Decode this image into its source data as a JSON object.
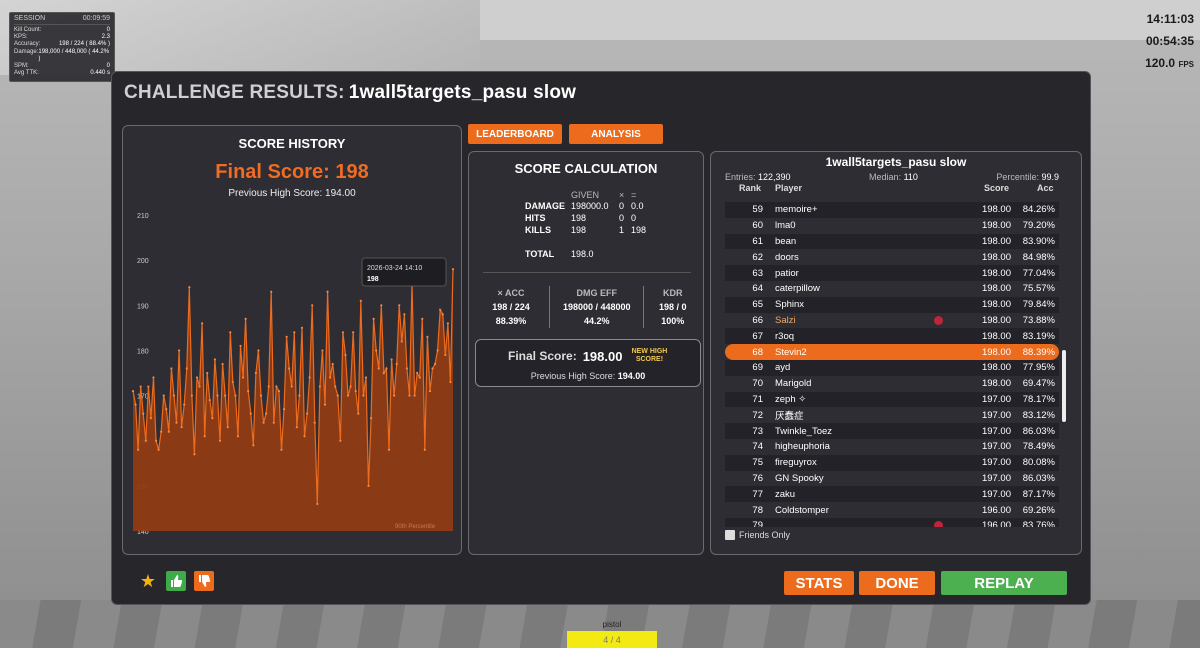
{
  "session": {
    "label": "SESSION",
    "time": "00:09:59",
    "rows": [
      {
        "k": "Kill Count:",
        "v": "0"
      },
      {
        "k": "KPS:",
        "v": "2.3"
      },
      {
        "k": "Accuracy:",
        "v": "198 / 224  ( 88.4% )"
      },
      {
        "k": "Damage:",
        "v": "198,000 / 448,000  ( 44.2% )"
      },
      {
        "k": "SPM:",
        "v": "0"
      },
      {
        "k": "Avg TTK:",
        "v": "0.440 s"
      }
    ]
  },
  "hud": {
    "clock": "14:11:03",
    "timer": "00:54:35",
    "fps": "120.0",
    "fps_unit": "FPS"
  },
  "header": {
    "prefix": "CHALLENGE RESULTS:",
    "scenario": "1wall5targets_pasu slow"
  },
  "score_history": {
    "title": "SCORE HISTORY",
    "final": "Final Score: 198",
    "previous": "Previous High Score: 194.00",
    "tooltip_date": "2026-03-24 14:10",
    "tooltip_value": "198",
    "percentile_label": "90th Percentile"
  },
  "chart_data": {
    "type": "area",
    "title": "SCORE HISTORY",
    "xlabel": "",
    "ylabel": "",
    "ylim": [
      140,
      212
    ],
    "yticks": [
      140,
      150,
      160,
      170,
      180,
      190,
      200,
      210
    ],
    "color": "#ec6b1d",
    "values": [
      171,
      168,
      158,
      172,
      166,
      160,
      172,
      165,
      174,
      160,
      158,
      162,
      170,
      167,
      162,
      176,
      170,
      164,
      180,
      163,
      168,
      176,
      194,
      170,
      157,
      174,
      172,
      186,
      161,
      175,
      169,
      165,
      178,
      170,
      160,
      177,
      170,
      163,
      184,
      173,
      170,
      161,
      181,
      174,
      187,
      171,
      166,
      159,
      175,
      180,
      170,
      164,
      166,
      172,
      193,
      164,
      172,
      171,
      158,
      167,
      183,
      176,
      172,
      184,
      163,
      170,
      185,
      161,
      166,
      174,
      190,
      164,
      146,
      172,
      180,
      168,
      193,
      174,
      177,
      172,
      170,
      160,
      184,
      179,
      170,
      172,
      184,
      171,
      166,
      191,
      170,
      174,
      150,
      165,
      187,
      180,
      176,
      190,
      175,
      176,
      158,
      178,
      170,
      177,
      190,
      182,
      188,
      176,
      170,
      195,
      170,
      175,
      174,
      187,
      158,
      183,
      171,
      176,
      177,
      180,
      189,
      188,
      179,
      186,
      173,
      198
    ]
  },
  "tabs": {
    "leaderboard": "LEADERBOARD",
    "analysis": "ANALYSIS"
  },
  "calc": {
    "title": "SCORE CALCULATION",
    "hdr_given": "GIVEN",
    "hdr_x": "×",
    "hdr_eq": "=",
    "rows": [
      {
        "name": "DAMAGE",
        "given": "198000.0",
        "x": "0",
        "eq": "0.0"
      },
      {
        "name": "HITS",
        "given": "198",
        "x": "0",
        "eq": "0"
      },
      {
        "name": "KILLS",
        "given": "198",
        "x": "1",
        "eq": "198"
      }
    ],
    "total_label": "TOTAL",
    "total_value": "198.0",
    "metrics": [
      {
        "label": "× ACC",
        "ratio": "198 / 224",
        "pct": "88.39%"
      },
      {
        "label": "DMG EFF",
        "ratio": "198000 / 448000",
        "pct": "44.2%"
      },
      {
        "label": "KDR",
        "ratio": "198 / 0",
        "pct": "100%"
      }
    ],
    "final_label": "Final Score:",
    "final_value": "198.00",
    "new_high": "NEW HIGH SCORE!",
    "prev_label": "Previous High Score:",
    "prev_value": "194.00"
  },
  "leaderboard": {
    "title": "1wall5targets_pasu slow",
    "entries_label": "Entries:",
    "entries": "122,390",
    "median_label": "Median:",
    "median": "110",
    "percentile_label": "Percentile:",
    "percentile": "99.9",
    "col_rank": "Rank",
    "col_player": "Player",
    "col_score": "Score",
    "col_acc": "Acc",
    "rows": [
      {
        "rank": "59",
        "player": "memoire+",
        "score": "198.00",
        "acc": "84.26%"
      },
      {
        "rank": "60",
        "player": "lma0",
        "score": "198.00",
        "acc": "79.20%"
      },
      {
        "rank": "61",
        "player": "bean",
        "score": "198.00",
        "acc": "83.90%"
      },
      {
        "rank": "62",
        "player": "doors",
        "score": "198.00",
        "acc": "84.98%"
      },
      {
        "rank": "63",
        "player": "patior",
        "score": "198.00",
        "acc": "77.04%"
      },
      {
        "rank": "64",
        "player": "caterpillow",
        "score": "198.00",
        "acc": "75.57%"
      },
      {
        "rank": "65",
        "player": "Sphinx",
        "score": "198.00",
        "acc": "79.84%"
      },
      {
        "rank": "66",
        "player": "Salzi",
        "score": "198.00",
        "acc": "73.88%"
      },
      {
        "rank": "67",
        "player": "r3oq",
        "score": "198.00",
        "acc": "83.19%"
      },
      {
        "rank": "68",
        "player": "Stevin2",
        "score": "198.00",
        "acc": "88.39%"
      },
      {
        "rank": "69",
        "player": "ayd",
        "score": "198.00",
        "acc": "77.95%"
      },
      {
        "rank": "70",
        "player": "Marigold",
        "score": "198.00",
        "acc": "69.47%"
      },
      {
        "rank": "71",
        "player": "zeph ✧",
        "score": "197.00",
        "acc": "78.17%"
      },
      {
        "rank": "72",
        "player": "厌蠢症",
        "score": "197.00",
        "acc": "83.12%"
      },
      {
        "rank": "73",
        "player": "Twinkle_Toez",
        "score": "197.00",
        "acc": "86.03%"
      },
      {
        "rank": "74",
        "player": "higheuphoria",
        "score": "197.00",
        "acc": "78.49%"
      },
      {
        "rank": "75",
        "player": "fireguyrox",
        "score": "197.00",
        "acc": "80.08%"
      },
      {
        "rank": "76",
        "player": "GN Spooky",
        "score": "197.00",
        "acc": "86.03%"
      },
      {
        "rank": "77",
        "player": "zaku",
        "score": "197.00",
        "acc": "87.17%"
      },
      {
        "rank": "78",
        "player": "Coldstomper",
        "score": "196.00",
        "acc": "69.26%"
      },
      {
        "rank": "79",
        "player": "",
        "score": "196.00",
        "acc": "83.76%"
      }
    ],
    "friends_only": "Friends Only"
  },
  "buttons": {
    "stats": "STATS",
    "done": "DONE",
    "replay": "REPLAY"
  },
  "weapon": {
    "name": "pistol",
    "ammo": "4 / 4"
  }
}
